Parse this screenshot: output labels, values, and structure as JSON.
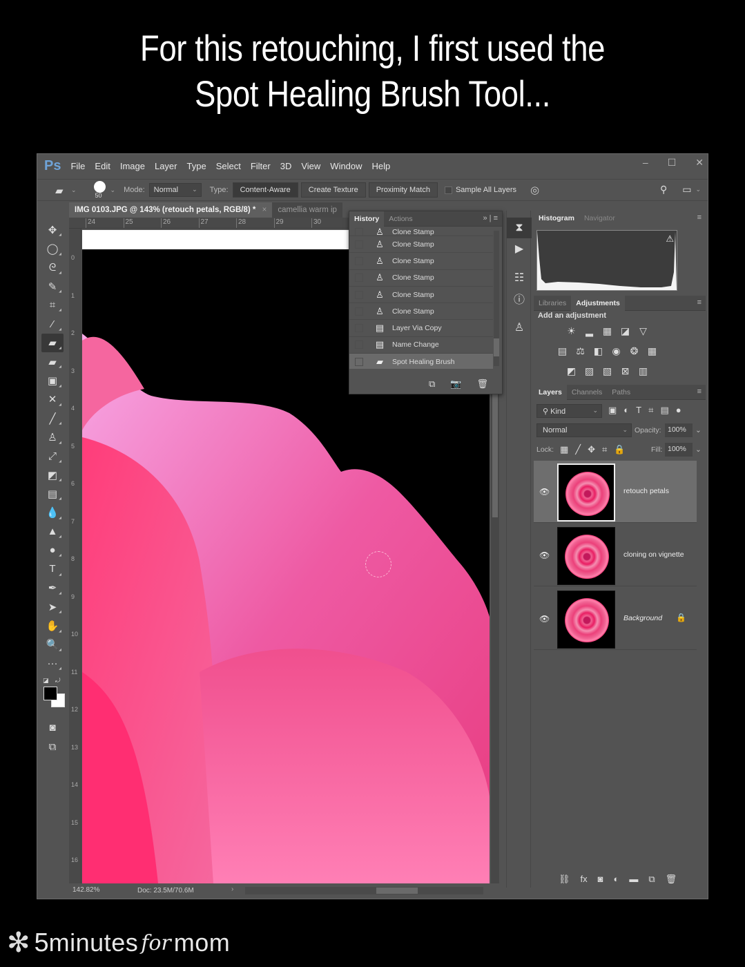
{
  "caption": {
    "line1": "For this retouching, I first used the",
    "line2": "Spot Healing Brush Tool..."
  },
  "app": {
    "logo": "Ps",
    "menu": [
      "File",
      "Edit",
      "Image",
      "Layer",
      "Type",
      "Select",
      "Filter",
      "3D",
      "View",
      "Window",
      "Help"
    ],
    "window_controls": {
      "minimize": "–",
      "maximize": "☐",
      "close": "✕"
    }
  },
  "options_bar": {
    "tool_icon": "spot-healing-brush-icon",
    "brush_size": "50",
    "mode_label": "Mode:",
    "mode_value": "Normal",
    "type_label": "Type:",
    "type_buttons": [
      {
        "label": "Content-Aware",
        "active": true
      },
      {
        "label": "Create Texture",
        "active": false
      },
      {
        "label": "Proximity Match",
        "active": false
      }
    ],
    "sample_all_layers_label": "Sample All Layers",
    "sample_all_layers_checked": false
  },
  "document": {
    "active_tab": "IMG 0103.JPG @ 143% (retouch petals, RGB/8) *",
    "inactive_tab": "camellia warm ip",
    "ruler_h": [
      "24",
      "25",
      "26",
      "27",
      "28",
      "29",
      "30"
    ],
    "ruler_v": [
      "0",
      "1",
      "2",
      "3",
      "4",
      "5",
      "6",
      "7",
      "8",
      "9",
      "10",
      "11",
      "12",
      "13",
      "14",
      "15",
      "16"
    ],
    "zoom": "142.82%",
    "doc_size": "Doc: 23.5M/70.6M"
  },
  "tools": [
    {
      "name": "move-tool",
      "glyph": "✥"
    },
    {
      "name": "elliptical-marquee-tool",
      "glyph": "◯"
    },
    {
      "name": "lasso-tool",
      "glyph": "ᘓ"
    },
    {
      "name": "quick-selection-tool",
      "glyph": "✎"
    },
    {
      "name": "crop-tool",
      "glyph": "⌗"
    },
    {
      "name": "eyedropper-tool",
      "glyph": "⁄"
    },
    {
      "name": "spot-healing-brush-tool",
      "glyph": "▰",
      "active": true
    },
    {
      "name": "healing-brush-tool",
      "glyph": "▰"
    },
    {
      "name": "patch-tool",
      "glyph": "▣"
    },
    {
      "name": "content-aware-move-tool",
      "glyph": "✕"
    },
    {
      "name": "brush-tool",
      "glyph": "╱"
    },
    {
      "name": "clone-stamp-tool",
      "glyph": "♙"
    },
    {
      "name": "history-brush-tool",
      "glyph": "⤢"
    },
    {
      "name": "eraser-tool",
      "glyph": "◩"
    },
    {
      "name": "gradient-tool",
      "glyph": "▤"
    },
    {
      "name": "blur-tool",
      "glyph": "💧"
    },
    {
      "name": "sharpen-tool",
      "glyph": "▲"
    },
    {
      "name": "dodge-tool",
      "glyph": "●"
    },
    {
      "name": "type-tool",
      "glyph": "T"
    },
    {
      "name": "pen-tool",
      "glyph": "✒"
    },
    {
      "name": "path-selection-tool",
      "glyph": "➤"
    },
    {
      "name": "hand-tool",
      "glyph": "✋"
    },
    {
      "name": "zoom-tool",
      "glyph": "🔍"
    },
    {
      "name": "more-tools",
      "glyph": "···"
    }
  ],
  "history_panel": {
    "tabs": [
      {
        "label": "History",
        "active": true
      },
      {
        "label": "Actions",
        "active": false
      }
    ],
    "items": [
      {
        "label": "Clone Stamp",
        "icon": "clone-stamp-icon",
        "partial": true
      },
      {
        "label": "Clone Stamp",
        "icon": "clone-stamp-icon"
      },
      {
        "label": "Clone Stamp",
        "icon": "clone-stamp-icon"
      },
      {
        "label": "Clone Stamp",
        "icon": "clone-stamp-icon"
      },
      {
        "label": "Clone Stamp",
        "icon": "clone-stamp-icon"
      },
      {
        "label": "Clone Stamp",
        "icon": "clone-stamp-icon"
      },
      {
        "label": "Layer Via Copy",
        "icon": "document-icon"
      },
      {
        "label": "Name Change",
        "icon": "document-icon"
      },
      {
        "label": "Spot Healing Brush",
        "icon": "spot-healing-brush-icon",
        "selected": true
      }
    ]
  },
  "histogram_panel": {
    "tabs": [
      {
        "label": "Histogram",
        "active": true
      },
      {
        "label": "Navigator",
        "active": false
      }
    ]
  },
  "adjustments_panel": {
    "tabs": [
      {
        "label": "Libraries",
        "active": false
      },
      {
        "label": "Adjustments",
        "active": true
      }
    ],
    "title": "Add an adjustment"
  },
  "layers_panel": {
    "tabs": [
      {
        "label": "Layers",
        "active": true
      },
      {
        "label": "Channels",
        "active": false
      },
      {
        "label": "Paths",
        "active": false
      }
    ],
    "filter": "Kind",
    "blend_mode": "Normal",
    "opacity_label": "Opacity:",
    "opacity": "100%",
    "lock_label": "Lock:",
    "fill_label": "Fill:",
    "fill": "100%",
    "layers": [
      {
        "name": "retouch petals",
        "visible": true,
        "selected": true,
        "locked": false
      },
      {
        "name": "cloning on vignette",
        "visible": true,
        "selected": false,
        "locked": false
      },
      {
        "name": "Background",
        "visible": true,
        "selected": false,
        "locked": true
      }
    ]
  },
  "footer_logo": {
    "five": "5",
    "minutes": "minutes",
    "for": "for",
    "mom": "mom"
  }
}
